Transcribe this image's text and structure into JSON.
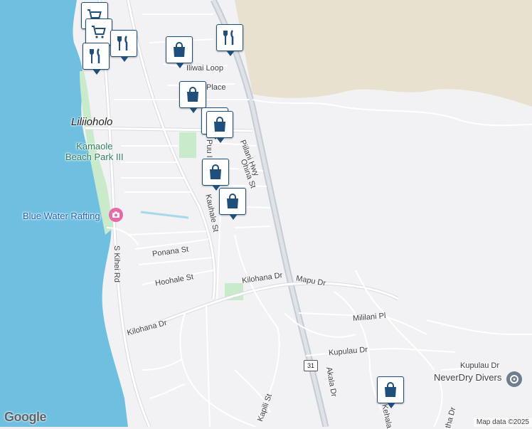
{
  "map": {
    "places": {
      "lliholo": "Liliioholo",
      "park": "Kamaole\nBeach Park III",
      "rafting": "Blue Water Rafting",
      "divers": "NeverDry Divers"
    },
    "streets": {
      "iliwai": "Iliwai Loop",
      "place": "Place",
      "piilani": "Piilani Hwy",
      "puul": "Puu I",
      "ohina": "Ohina St",
      "kauhale": "Kauhale St",
      "ponana": "Ponana St",
      "hoohale": "Hoohale St",
      "kilohana1": "Kilohana Dr",
      "kilohana2": "Kilohana Dr",
      "mapu": "Mapu Dr",
      "mililani": "Mililani Pl",
      "kupulau1": "Kupulau Dr",
      "kupulau2": "Kupulau Dr",
      "akala": "Akala Dr",
      "kapili": "Kapili St",
      "skihei": "S Kihei Rd",
      "kehala": "Kehala",
      "nadr": "tha Dr",
      "st": "t"
    },
    "route_shield": "31",
    "brand": "Google",
    "attribution": "Map data ©2025",
    "colors": {
      "ocean": "#6fc0e0",
      "land": "#f2f2f4",
      "dryland": "#e8e1d0",
      "park": "#c9eacb",
      "road": "#ffffff",
      "highway": "#c5ccd3",
      "pin_border": "#1f4f7a"
    },
    "pins": [
      {
        "icon": "cart-icon"
      },
      {
        "icon": "cart-icon"
      },
      {
        "icon": "restaurant-icon"
      },
      {
        "icon": "restaurant-icon"
      },
      {
        "icon": "restaurant-icon"
      },
      {
        "icon": "shopping-bag-icon"
      },
      {
        "icon": "shopping-bag-icon"
      },
      {
        "icon": "shopping-bag-icon"
      },
      {
        "icon": "shopping-bag-icon"
      },
      {
        "icon": "shopping-bag-icon"
      },
      {
        "icon": "shopping-bag-icon"
      }
    ]
  }
}
